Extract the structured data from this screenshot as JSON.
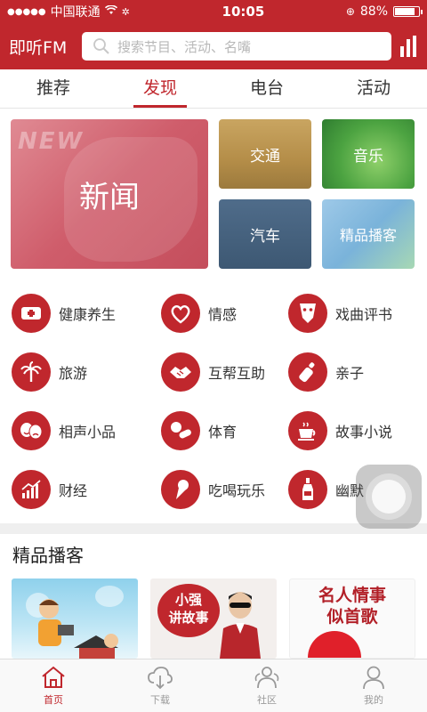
{
  "status_bar": {
    "carrier": "中国联通",
    "time": "10:05",
    "battery": "88%"
  },
  "header": {
    "logo": "即听FM",
    "search_placeholder": "搜索节目、活动、名嘴"
  },
  "tabs": [
    {
      "label": "推荐",
      "active": false
    },
    {
      "label": "发现",
      "active": true
    },
    {
      "label": "电台",
      "active": false
    },
    {
      "label": "活动",
      "active": false
    }
  ],
  "featured": {
    "news": {
      "label": "新闻",
      "overlay_text": "NEW"
    },
    "traffic": {
      "label": "交通"
    },
    "music": {
      "label": "音乐"
    },
    "car": {
      "label": "汽车"
    },
    "podcast": {
      "label": "精品播客"
    }
  },
  "categories": [
    {
      "label": "健康养生",
      "icon": "health-kit-icon"
    },
    {
      "label": "情感",
      "icon": "heart-hands-icon"
    },
    {
      "label": "戏曲评书",
      "icon": "opera-mask-icon"
    },
    {
      "label": "旅游",
      "icon": "palm-tree-icon"
    },
    {
      "label": "互帮互助",
      "icon": "handshake-icon"
    },
    {
      "label": "亲子",
      "icon": "baby-bottle-icon"
    },
    {
      "label": "相声小品",
      "icon": "comedy-masks-icon"
    },
    {
      "label": "体育",
      "icon": "sports-icon"
    },
    {
      "label": "故事小说",
      "icon": "coffee-cup-icon"
    },
    {
      "label": "财经",
      "icon": "chart-growth-icon"
    },
    {
      "label": "吃喝玩乐",
      "icon": "ice-cream-icon"
    },
    {
      "label": "幽默",
      "icon": "bottle-icon"
    }
  ],
  "podcasts": {
    "section_title": "精品播客",
    "items": [
      {
        "title": ""
      },
      {
        "title": "小强讲故事"
      },
      {
        "title": "名人情事似首歌"
      }
    ]
  },
  "tabbar": [
    {
      "label": "首页",
      "icon": "home-icon",
      "active": true
    },
    {
      "label": "下载",
      "icon": "cloud-download-icon",
      "active": false
    },
    {
      "label": "社区",
      "icon": "community-icon",
      "active": false
    },
    {
      "label": "我的",
      "icon": "person-icon",
      "active": false
    }
  ],
  "colors": {
    "brand": "#c0272d",
    "text": "#333333",
    "inactive": "#999999"
  }
}
